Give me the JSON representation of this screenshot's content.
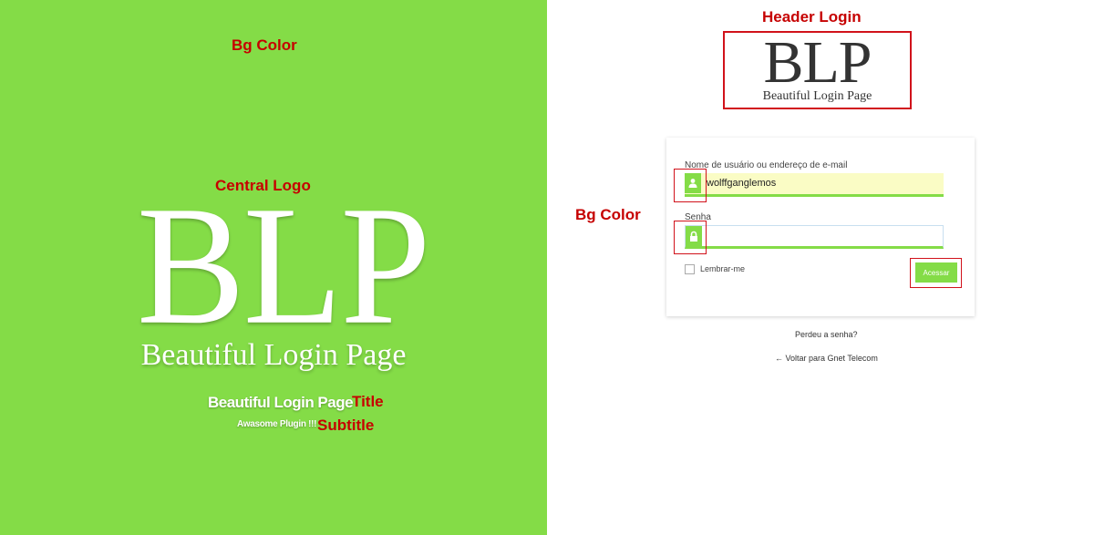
{
  "annotations": {
    "bg_color_left": "Bg Color",
    "central_logo": "Central Logo",
    "title": "Title",
    "subtitle": "Subtitle",
    "header_login": "Header Login",
    "bg_color_right": "Bg Color"
  },
  "left_panel": {
    "background": "#84dc47",
    "logo_mark": "BLP",
    "logo_tagline": "Beautiful Login Page",
    "title": "Beautiful Login Page",
    "subtitle": "Awasome Plugin !!!"
  },
  "header_logo": {
    "mark": "BLP",
    "tagline": "Beautiful Login Page"
  },
  "login_form": {
    "username_label": "Nome de usuário ou endereço de e-mail",
    "username_value": "wolffganglemos",
    "username_icon": "user-icon",
    "password_label": "Senha",
    "password_value": "",
    "password_icon": "lock-icon",
    "remember_label": "Lembrar-me",
    "remember_checked": false,
    "submit_label": "Acessar"
  },
  "links": {
    "lost_password": "Perdeu a senha?",
    "back_to_site": "← Voltar para Gnet Telecom"
  },
  "colors": {
    "accent": "#84dc47",
    "annotation_red": "#c60000",
    "input_fill": "#fafcc5"
  }
}
